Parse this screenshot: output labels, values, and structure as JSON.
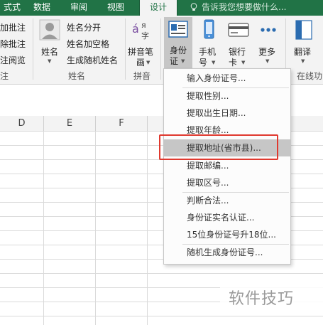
{
  "menubar": {
    "tabs": [
      {
        "label": "式式"
      },
      {
        "label": "数据"
      },
      {
        "label": "审阅"
      },
      {
        "label": "视图"
      },
      {
        "label": "设计"
      }
    ],
    "tell_me": "告诉我您想要做什么..."
  },
  "ribbon": {
    "left_group": {
      "items": [
        "加批注",
        "除批注",
        "注阅览"
      ],
      "label": "注"
    },
    "name_group": {
      "big_button": "姓名",
      "items": [
        "姓名分开",
        "姓名加空格",
        "生成随机姓名"
      ],
      "label": "姓名"
    },
    "pinyin_group": {
      "button_line1": "拼音笔",
      "button_line2": "画",
      "label": "拼音"
    },
    "buttons": {
      "id_line1": "身份",
      "id_line2": "证",
      "phone_line1": "手机",
      "phone_line2": "号",
      "bank_line1": "银行",
      "bank_line2": "卡",
      "more": "更多",
      "translate": "翻译"
    },
    "online_label": "在线功"
  },
  "columns": [
    "D",
    "E",
    "F"
  ],
  "dropdown": {
    "items": [
      "输入身份证号...",
      "提取性别...",
      "提取出生日期...",
      "提取年龄...",
      "提取地址(省市县)...",
      "提取邮编...",
      "提取区号...",
      "判断合法...",
      "身份证实名认证...",
      "15位身份证号升18位...",
      "随机生成身份证号..."
    ],
    "highlighted_index": 4
  },
  "watermark": "软件技巧",
  "colors": {
    "accent": "#217346",
    "highlight": "#c6c6c6",
    "callout": "#e0392f"
  }
}
